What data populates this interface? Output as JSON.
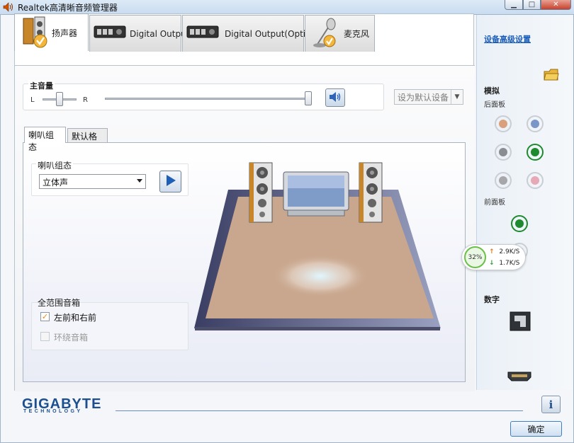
{
  "window": {
    "title": "Realtek高清晰音频管理器"
  },
  "device_tabs": [
    {
      "label": "扬声器",
      "icon": "speaker-icon",
      "active": true
    },
    {
      "label": "Digital Output",
      "icon": "digital-output-icon",
      "active": false
    },
    {
      "label": "Digital Output(Optical)",
      "icon": "optical-output-icon",
      "active": false
    },
    {
      "label": "麦克风",
      "icon": "microphone-icon",
      "active": false
    }
  ],
  "volume": {
    "title": "主音量",
    "left_label": "L",
    "right_label": "R",
    "balance": 0.5,
    "level": 1.0,
    "mute_icon": "speaker-volume-icon"
  },
  "default_device": {
    "label": "设为默认设备"
  },
  "sub_tabs": [
    {
      "label": "喇叭组态",
      "active": true
    },
    {
      "label": "默认格式",
      "active": false
    }
  ],
  "speaker_config": {
    "group_title": "喇叭组态",
    "selected": "立体声",
    "play_icon": "play-icon"
  },
  "full_range": {
    "title": "全范围音箱",
    "options": [
      {
        "label": "左前和右前",
        "checked": true,
        "enabled": true
      },
      {
        "label": "环绕音箱",
        "checked": false,
        "enabled": false
      }
    ]
  },
  "sidebar": {
    "advanced_link": "设备高级设置",
    "analog_title": "模拟",
    "rear_panel": "后面板",
    "front_panel": "前面板",
    "digital_title": "数字",
    "rear_jacks": [
      {
        "color": "#d9a07d"
      },
      {
        "color": "#7a96c9"
      },
      {
        "color": "#8a8d92"
      },
      {
        "color": "#1d8a2f"
      },
      {
        "color": "#a5a7aa"
      },
      {
        "color": "#e6a9b5"
      }
    ],
    "front_jacks": [
      {
        "color": "#1d8a2f"
      },
      {
        "color": "#e6a9b5"
      }
    ],
    "folder_icon": "folder-icon",
    "spdif_icon": "spdif-port-icon",
    "hdmi_icon": "hdmi-port-icon"
  },
  "net_meter": {
    "percent": "32%",
    "upload": "2.9K/S",
    "download": "1.7K/S"
  },
  "footer": {
    "brand": "GIGABYTE",
    "brand_sub": "TECHNOLOGY",
    "info_label": "i",
    "ok_label": "确定"
  },
  "colors": {
    "accent": "#1d5fb8",
    "floor": "#c9a78e"
  }
}
